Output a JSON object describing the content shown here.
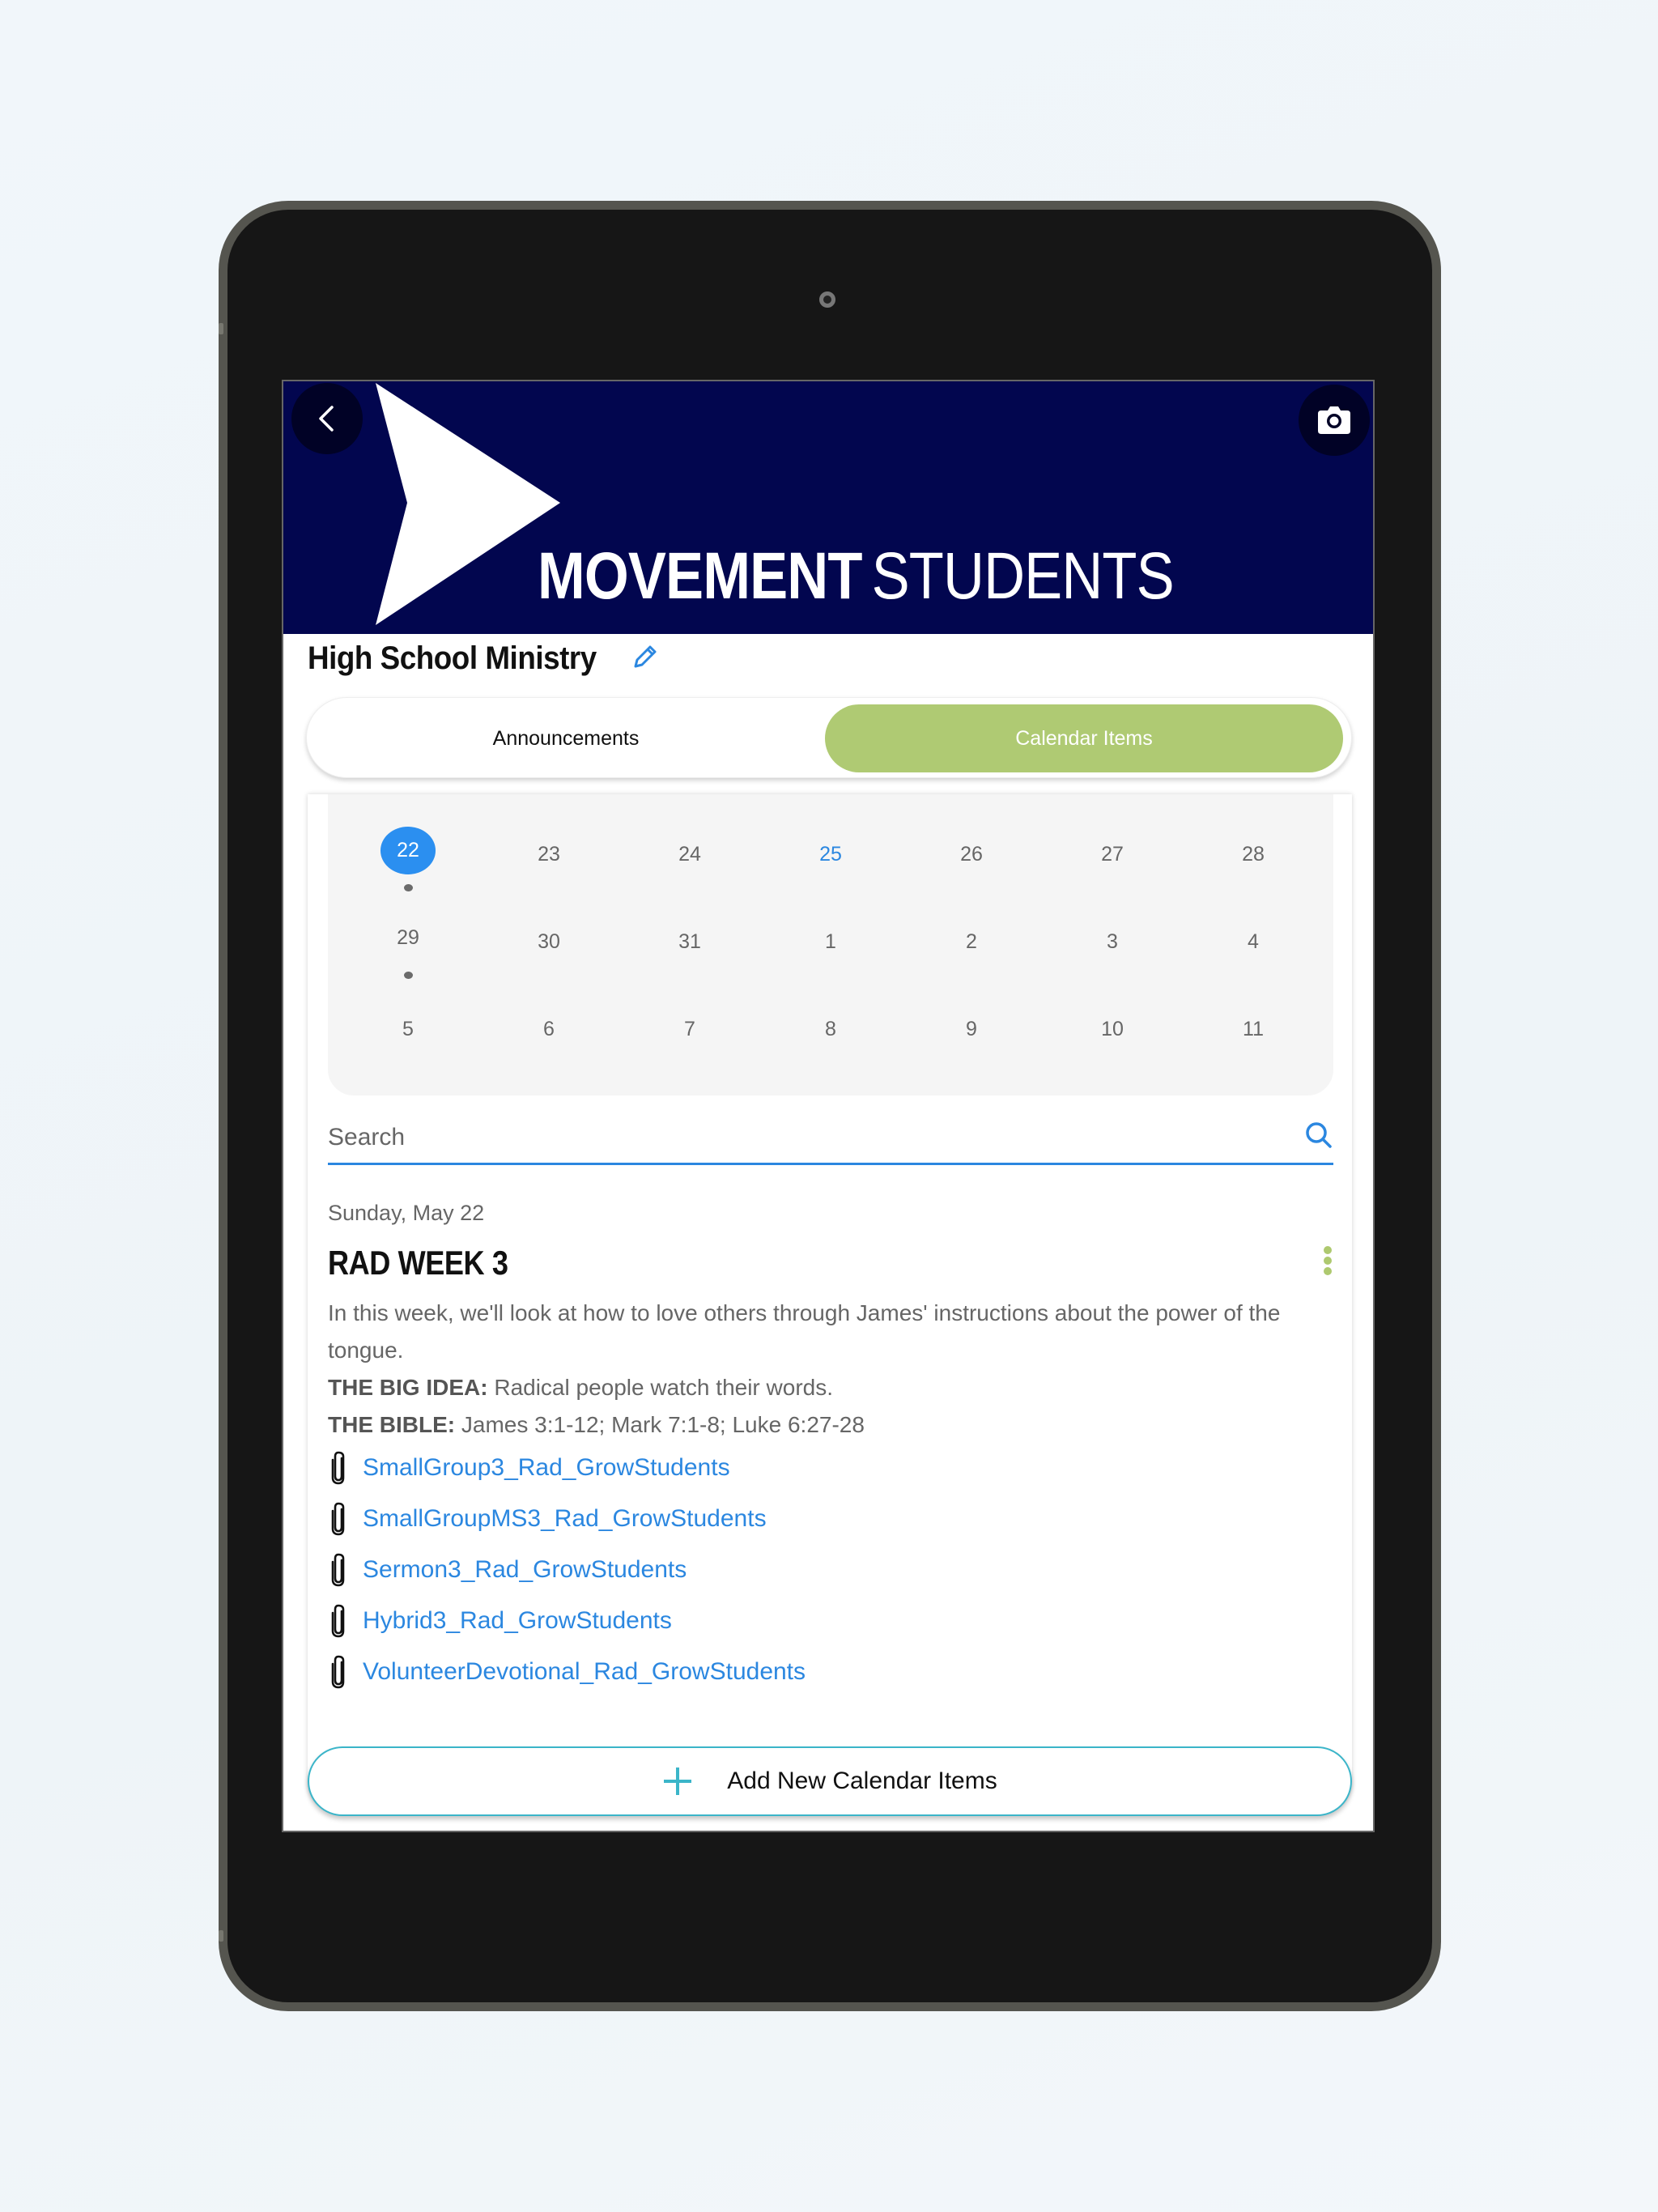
{
  "header": {
    "brand_bold": "MOVEMENT",
    "brand_light": "STUDENTS",
    "back_icon": "chevron-left-icon",
    "camera_icon": "camera-icon",
    "colors": {
      "header_bg": "#02064f",
      "accent_green": "#afca73",
      "link_blue": "#2b87e0",
      "selected_blue": "#2b8ff0",
      "add_border": "#3bb5c9"
    }
  },
  "group": {
    "title": "High School Ministry",
    "edit_icon": "pencil-icon"
  },
  "tabs": [
    {
      "label": "Announcements",
      "active": false
    },
    {
      "label": "Calendar Items",
      "active": true
    }
  ],
  "calendar": {
    "weeks": [
      [
        {
          "day": "22",
          "selected": true,
          "dot": true
        },
        {
          "day": "23"
        },
        {
          "day": "24"
        },
        {
          "day": "25",
          "today": true
        },
        {
          "day": "26"
        },
        {
          "day": "27"
        },
        {
          "day": "28"
        }
      ],
      [
        {
          "day": "29",
          "dot": true
        },
        {
          "day": "30"
        },
        {
          "day": "31"
        },
        {
          "day": "1"
        },
        {
          "day": "2"
        },
        {
          "day": "3"
        },
        {
          "day": "4"
        }
      ],
      [
        {
          "day": "5"
        },
        {
          "day": "6"
        },
        {
          "day": "7"
        },
        {
          "day": "8"
        },
        {
          "day": "9"
        },
        {
          "day": "10"
        },
        {
          "day": "11"
        }
      ]
    ]
  },
  "search": {
    "placeholder": "Search",
    "value": "",
    "icon": "search-icon"
  },
  "event": {
    "date": "Sunday, May 22",
    "title": "RAD WEEK 3",
    "description": "In this week, we'll look at how to love others through James' instructions about the power of the tongue.",
    "big_idea_label": "THE BIG IDEA:",
    "big_idea": "Radical people watch their words.",
    "bible_label": "THE BIBLE:",
    "bible": "James 3:1-12; Mark 7:1-8; Luke 6:27-28",
    "menu_icon": "more-vertical-icon",
    "attachments": [
      "SmallGroup3_Rad_GrowStudents",
      "SmallGroupMS3_Rad_GrowStudents",
      "Sermon3_Rad_GrowStudents",
      "Hybrid3_Rad_GrowStudents",
      "VolunteerDevotional_Rad_GrowStudents"
    ]
  },
  "add_button": {
    "label": "Add New Calendar Items",
    "icon": "plus-icon"
  }
}
